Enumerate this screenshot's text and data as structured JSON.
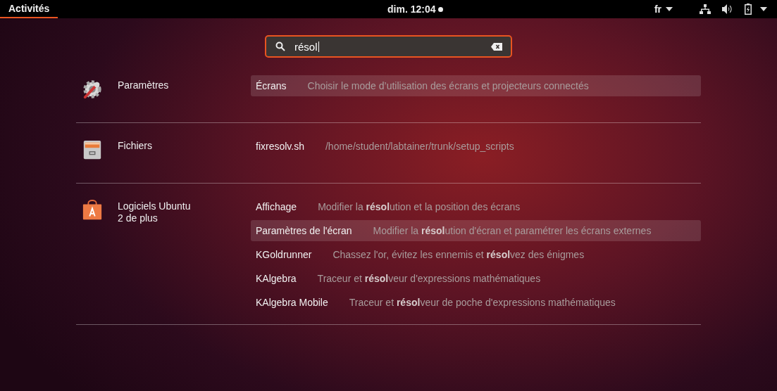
{
  "top_bar": {
    "activities": {
      "label": "Activités",
      "selected": true
    },
    "clock": "dim. 12:04",
    "notification": true,
    "language": "fr"
  },
  "search": {
    "value": "résol"
  },
  "sections": [
    {
      "source": {
        "name": "Paramètres",
        "kind": "settings"
      },
      "results": [
        {
          "name": "Écrans",
          "description": "Choisir le mode d’utilisation des écrans et projecteurs connectés",
          "selected": true
        }
      ]
    },
    {
      "source": {
        "name": "Fichiers",
        "kind": "files"
      },
      "results": [
        {
          "name": "fixresolv.sh",
          "description": "/home/student/labtainer/trunk/setup_scripts",
          "selected": false
        }
      ]
    },
    {
      "source": {
        "name": "Logiciels Ubuntu",
        "more": "2 de plus",
        "kind": "software"
      },
      "results": [
        {
          "name": "Affichage",
          "description": "Modifier la **résol**ution et la position des écrans",
          "selected": false
        },
        {
          "name": "Paramètres de l'écran",
          "description": "Modifier la **résol**ution d'écran et paramétrer les écrans externes",
          "selected": true
        },
        {
          "name": "KGoldrunner",
          "description": "Chassez l'or, évitez les ennemis et **résol**vez des énigmes",
          "selected": false
        },
        {
          "name": "KAlgebra",
          "description": "Traceur et **résol**veur d'expressions mathématiques",
          "selected": false
        },
        {
          "name": "KAlgebra Mobile",
          "description": "Traceur et **résol**veur de poche d'expressions mathématiques",
          "selected": false
        }
      ]
    }
  ]
}
